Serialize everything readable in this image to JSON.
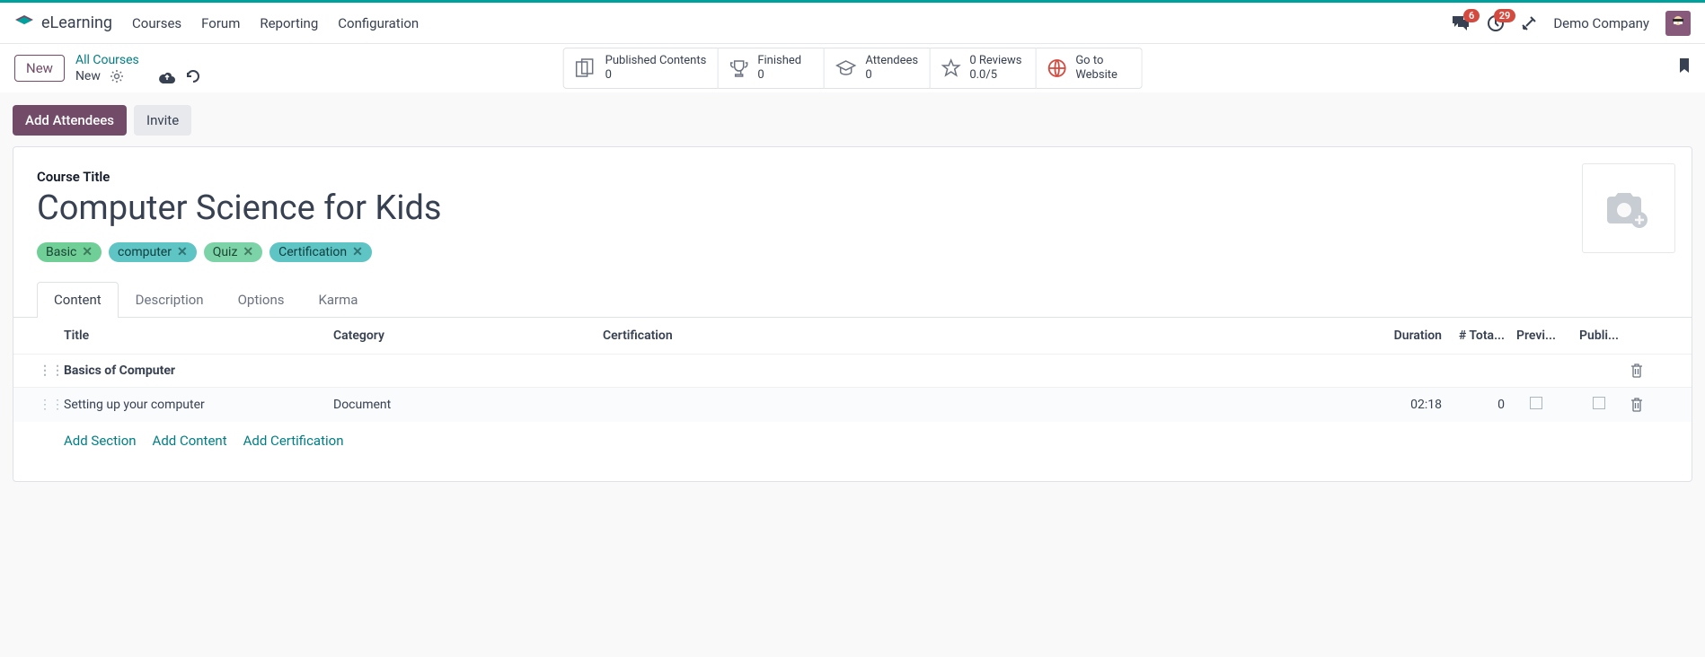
{
  "brand": "eLearning",
  "nav": {
    "courses": "Courses",
    "forum": "Forum",
    "reporting": "Reporting",
    "configuration": "Configuration"
  },
  "badges": {
    "messages": "6",
    "activities": "29"
  },
  "company": "Demo Company",
  "toolbar": {
    "new": "New",
    "all_courses": "All Courses",
    "new2": "New"
  },
  "stats": {
    "published": {
      "label": "Published Contents",
      "value": "0"
    },
    "finished": {
      "label": "Finished",
      "value": "0"
    },
    "attendees": {
      "label": "Attendees",
      "value": "0"
    },
    "reviews": {
      "label": "0 Reviews",
      "value": "0.0/5"
    },
    "website": {
      "label": "Go to",
      "value": "Website"
    }
  },
  "actions": {
    "add_attendees": "Add Attendees",
    "invite": "Invite"
  },
  "course": {
    "label": "Course Title",
    "title": "Computer Science for Kids"
  },
  "tags": [
    {
      "label": "Basic",
      "cls": "tag-green"
    },
    {
      "label": "computer",
      "cls": "tag-teal"
    },
    {
      "label": "Quiz",
      "cls": "tag-mint"
    },
    {
      "label": "Certification",
      "cls": "tag-cyan"
    }
  ],
  "tabs": {
    "content": "Content",
    "description": "Description",
    "options": "Options",
    "karma": "Karma"
  },
  "table": {
    "headers": {
      "title": "Title",
      "category": "Category",
      "certification": "Certification",
      "duration": "Duration",
      "total": "# Tota...",
      "previ": "Previ...",
      "publi": "Publi..."
    },
    "section": "Basics of Computer",
    "row": {
      "title": "Setting up your computer",
      "category": "Document",
      "duration": "02:18",
      "total": "0"
    }
  },
  "addlinks": {
    "section": "Add Section",
    "content": "Add Content",
    "cert": "Add Certification"
  }
}
